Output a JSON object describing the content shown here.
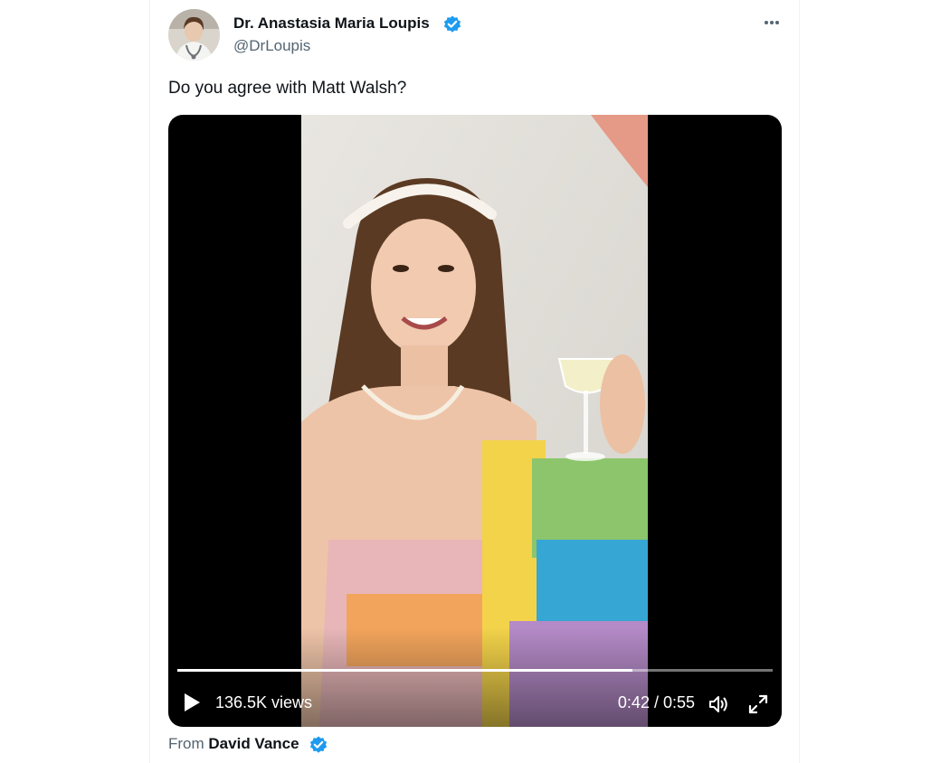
{
  "tweet": {
    "author": {
      "display_name": "Dr. Anastasia Maria Loupis",
      "handle": "@DrLoupis",
      "verified": true,
      "avatar": "profile-photo"
    },
    "more_icon": "more-horizontal-icon",
    "text": "Do you agree with Matt Walsh?",
    "video": {
      "thumbnail": "video-frame-photo",
      "views": "136.5K views",
      "time": "0:42 / 0:55",
      "progress": 0.764,
      "play_icon": "play-icon",
      "volume_icon": "volume-icon",
      "fullscreen_icon": "fullscreen-icon"
    },
    "source": {
      "prefix": "From",
      "name": "David Vance",
      "verified": true
    }
  },
  "colors": {
    "verified_blue": "#1d9bf0",
    "text_primary": "#0f1419",
    "text_secondary": "#536471",
    "video_bg": "#000000"
  }
}
